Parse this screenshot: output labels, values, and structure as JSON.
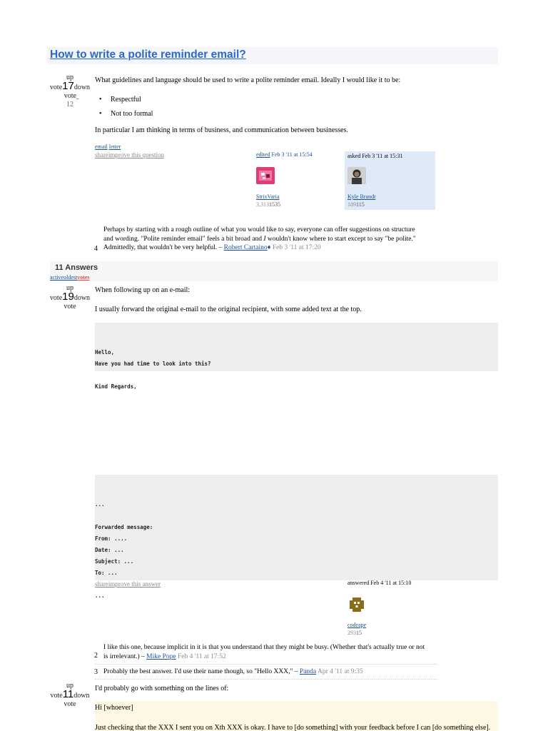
{
  "question": {
    "title": "How to write a polite reminder email?",
    "votes": {
      "up": "up",
      "vote1": "vote",
      "count": "17",
      "down": "down",
      "vote2": "vote",
      "favorite": "12"
    },
    "intro": "What guidelines and language should be used to write a polite reminder email. Ideally I would like it to be:",
    "bullets": [
      "Respectful",
      "Not too formal"
    ],
    "para": "In particular I am thinking in terms of business, and communication between businesses.",
    "tags": [
      "email",
      "letter"
    ],
    "share": "shareimprove this question",
    "edited": {
      "label": "edited",
      "when": "Feb 3 '11 at 15:54",
      "user": "StrixVaria",
      "rep": "3,313",
      "badges": "1535"
    },
    "asked": {
      "label": "asked Feb 3 '11 at 15:31",
      "user": "Kyle Brandt",
      "rep": "189",
      "badges": "115"
    },
    "comment": {
      "score": "4",
      "line1": "Perhaps by starting with a rough outline of what you would like to say, everyone can offer suggestions on structure",
      "line2a": "and wording. \"Polite reminder email\" feels a bit broad and ",
      "line2i": "I",
      "line2b": " wouldn't know where to start except to say \"be polite.\"",
      "line3": "Admittedly, that wouldn't be very helpful. – ",
      "user": "Robert Cartaino",
      "mod": "♦",
      "when": "Feb 3 '11 at 17:20"
    }
  },
  "answers_header": {
    "title": "11 Answers",
    "sort_active": "active",
    "sort_oldest": "oldest",
    "sort_votes": "votes"
  },
  "answer1": {
    "votes": {
      "up": "up",
      "vote1": "vote",
      "count": "19",
      "down": "down",
      "vote2": "vote"
    },
    "line1": "When following up on an e-mail:",
    "line2": "I usually forward the original e-mail to the original recipient, with some added text at the top.",
    "code1": [
      "Hello,",
      "Have you had time to look into this?",
      "",
      "Kind Regards,"
    ],
    "code2": [
      "...",
      "",
      "Forwarded message:",
      "From: ....",
      "Date: ...",
      "Subject: ...",
      "To: ...",
      "",
      "..."
    ],
    "share": "shareimprove this answer",
    "answered": {
      "label": "answered Feb 4 '11 at 15:10",
      "user": "codeape",
      "rep": "293",
      "badges": "15"
    },
    "comments": [
      {
        "score": "2",
        "line1": "I like this one, because implicit in it is that you understand that they might be busy. (Whether that's actually true or not",
        "line2": "is irrelevant.) – ",
        "user": "Mike Pope",
        "when": "Feb 4 '11 at 17:52"
      },
      {
        "score": "3",
        "line1": "Probably the best answer. I'd use their name though, so \"Hello XXX,\" – ",
        "user": "Panda",
        "when": "Apr 4 '11 at 9:35"
      }
    ]
  },
  "answer2": {
    "votes": {
      "up": "up",
      "vote1": "vote",
      "count": "11",
      "down": "down",
      "vote2": "vote"
    },
    "line1": "I'd probably go with something on the lines of:",
    "quote1": "Hi [whoever]",
    "quote2": "Just checking that the XXX I sent you on Xth XXX is okay. I have to [do something] with your feedback before I can [do something else]."
  },
  "colors": {
    "title": "#2b69c6",
    "link": "#1a4f9c",
    "owner_bg": "#dfeaf8",
    "code_bg": "#eeeeee",
    "quote_bg": "#fdf7e3",
    "votes_sort": "#e74c3c"
  }
}
